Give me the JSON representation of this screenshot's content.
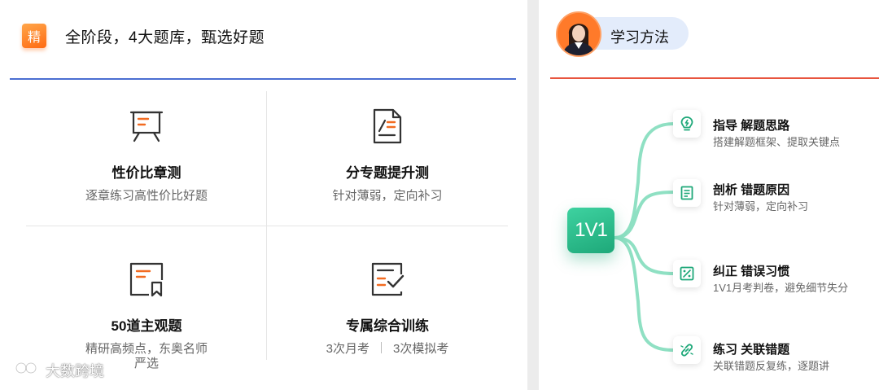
{
  "left": {
    "badge": "精",
    "title": "全阶段，4大题库，甄选好题",
    "cells": [
      {
        "title": "性价比章测",
        "sub": "逐章练习高性价比好题",
        "icon": "presentation-board-icon"
      },
      {
        "title": "分专题提升测",
        "sub": "针对薄弱，定向补习",
        "icon": "document-edit-icon"
      },
      {
        "title": "50道主观题",
        "sub_line1": "精研高频点，东奥名师",
        "sub_line2": "严选",
        "icon": "bookmark-document-icon"
      },
      {
        "title": "专属综合训练",
        "sub_a": "3次月考",
        "sub_b": "3次模拟考",
        "icon": "checklist-icon"
      }
    ]
  },
  "watermark": "大数跨境",
  "right": {
    "method_label": "学习方法",
    "center_label": "1V1",
    "nodes": [
      {
        "title": "指导 解题思路",
        "sub": "搭建解题框架、提取关键点",
        "icon": "lightbulb-icon"
      },
      {
        "title": "剖析 错题原因",
        "sub": "针对薄弱，定向补习",
        "icon": "document-lines-icon"
      },
      {
        "title": "纠正 错误习惯",
        "sub": "1V1月考判卷，避免细节失分",
        "icon": "percent-square-icon"
      },
      {
        "title": "练习 关联错题",
        "sub": "关联错题反复练，逐题讲",
        "icon": "link-icon"
      }
    ]
  },
  "colors": {
    "accent_orange": "#ff6a12",
    "left_divider": "#4a6ed1",
    "right_divider": "#e8553e",
    "green": "#1ea879"
  }
}
